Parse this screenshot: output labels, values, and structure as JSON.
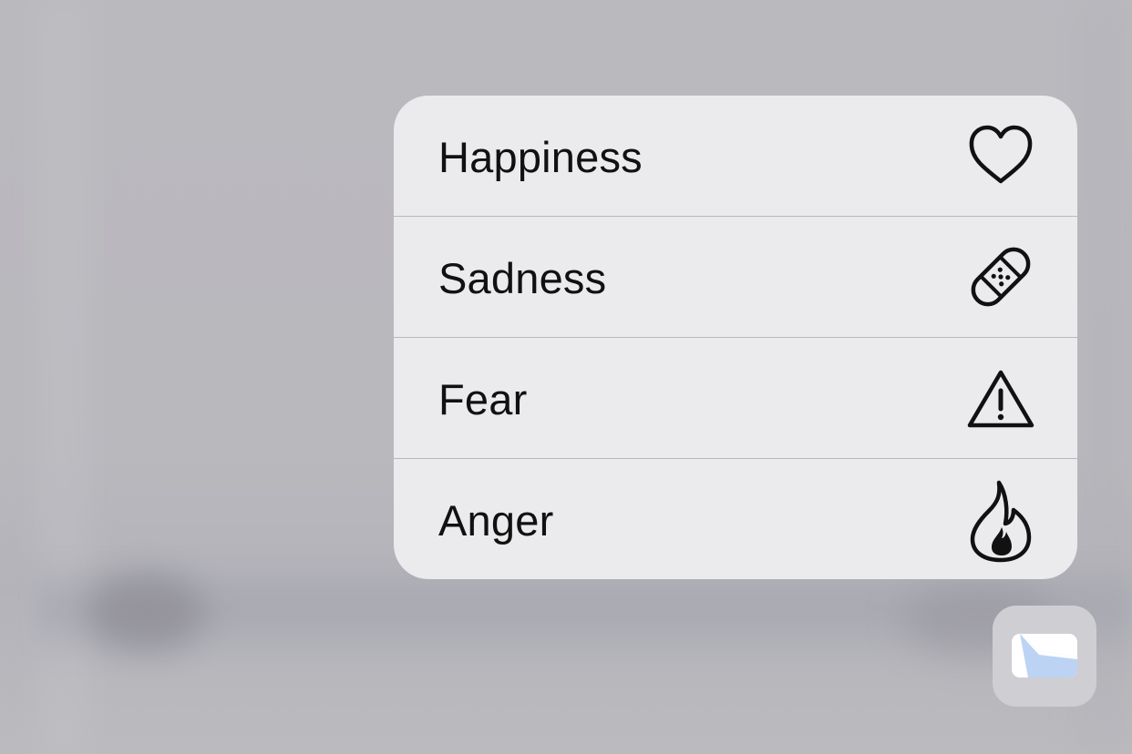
{
  "menu": {
    "items": [
      {
        "label": "Happiness",
        "icon": "heart-icon"
      },
      {
        "label": "Sadness",
        "icon": "bandage-icon"
      },
      {
        "label": "Fear",
        "icon": "warning-triangle-icon"
      },
      {
        "label": "Anger",
        "icon": "flame-icon"
      }
    ]
  },
  "app_button": {
    "icon": "emotions-app-icon"
  },
  "colors": {
    "menu_background": "#ebebed",
    "text": "#111111",
    "divider": "#b8b8bc",
    "page_background": "#bab9be",
    "app_glyph_fill": "#ffffff",
    "app_glyph_accent": "#bcd3f4"
  }
}
